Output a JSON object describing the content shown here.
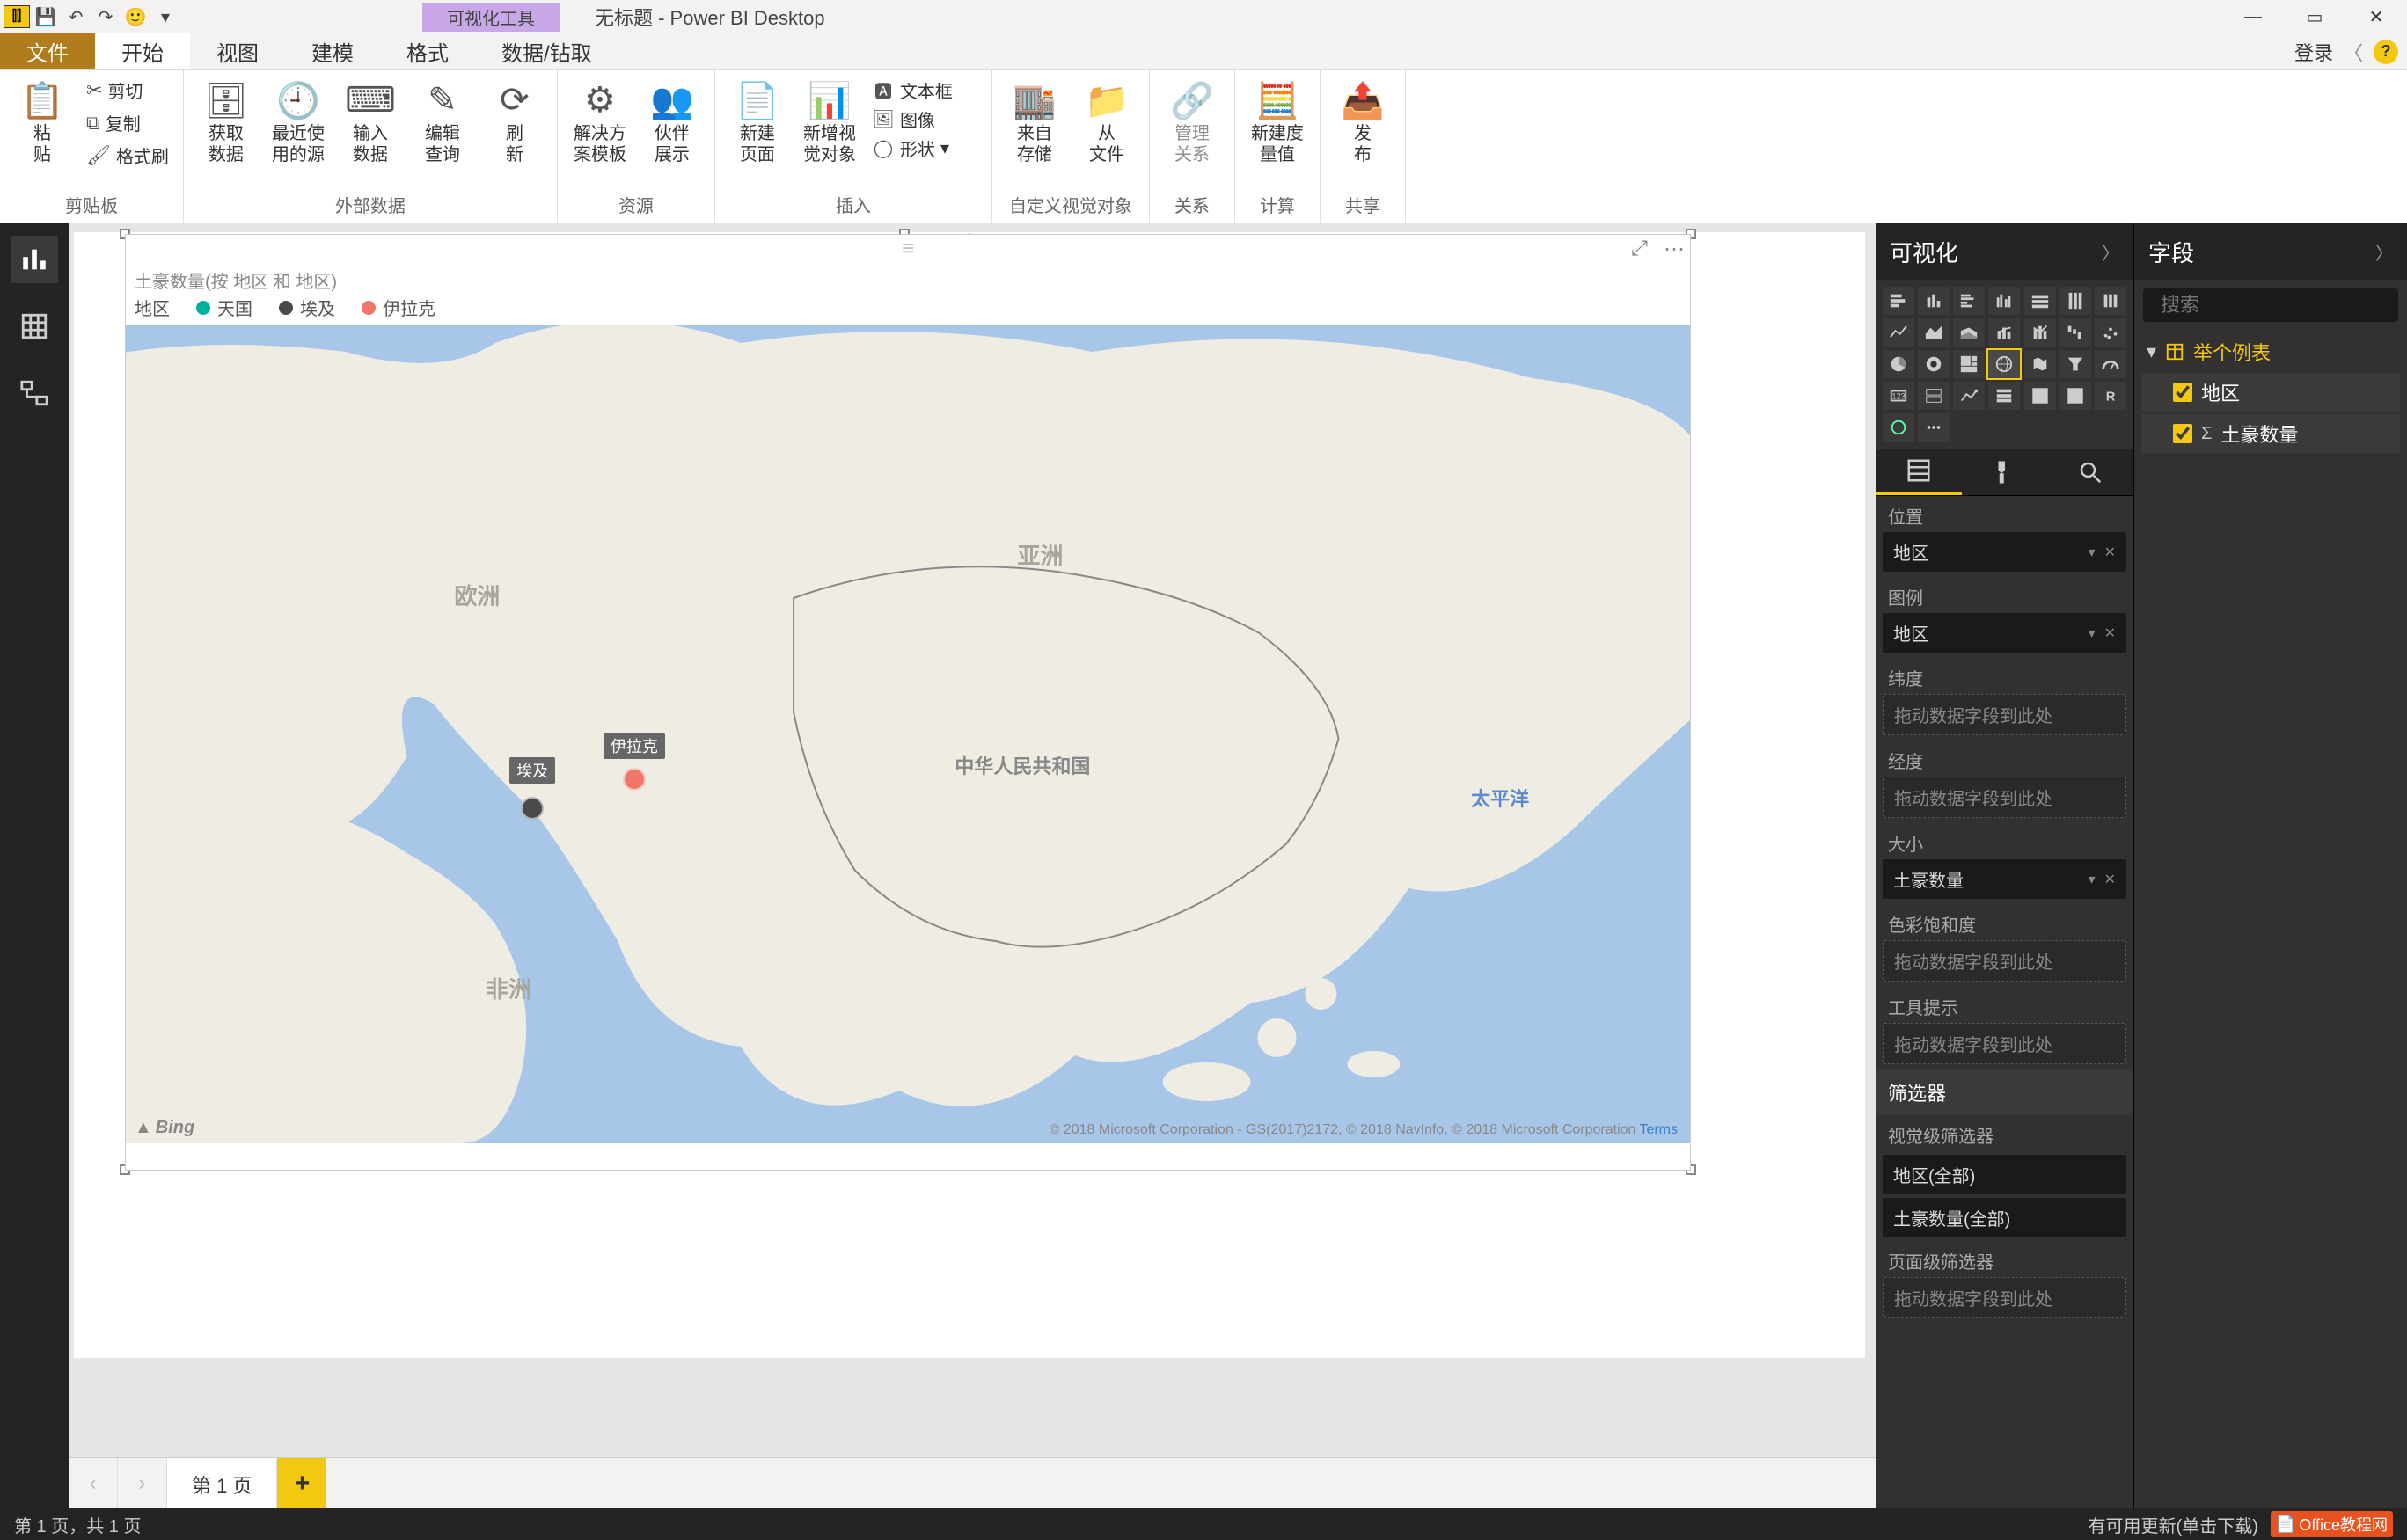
{
  "title_bar": {
    "viz_tools_label": "可视化工具",
    "title": "无标题 - Power BI Desktop",
    "qat": {
      "save": "💾",
      "undo": "↶",
      "redo": "↷",
      "smiley": "🙂"
    }
  },
  "tabs": {
    "file": "文件",
    "items": [
      "开始",
      "视图",
      "建模",
      "格式",
      "数据/钻取"
    ],
    "active": "开始",
    "signin": "登录"
  },
  "ribbon": {
    "clipboard": {
      "label": "剪贴板",
      "paste": "粘\n贴",
      "cut": "剪切",
      "copy": "复制",
      "format_painter": "格式刷"
    },
    "external_data": {
      "label": "外部数据",
      "get_data": "获取\n数据",
      "recent": "最近使\n用的源",
      "enter": "输入\n数据",
      "edit": "编辑\n查询",
      "refresh": "刷\n新"
    },
    "resources": {
      "label": "资源",
      "solutions": "解决方\n案模板",
      "partners": "伙伴\n展示"
    },
    "insert": {
      "label": "插入",
      "new_page": "新建\n页面",
      "new_visual": "新增视\n觉对象",
      "text_box": "文本框",
      "image": "图像",
      "shapes": "形状"
    },
    "custom_vis": {
      "label": "自定义视觉对象",
      "from_store": "来自\n存储",
      "from_file": "从\n文件"
    },
    "relationships": {
      "label": "关系",
      "manage": "管理\n关系"
    },
    "calc": {
      "label": "计算",
      "new_measure": "新建度\n量值"
    },
    "share": {
      "label": "共享",
      "publish": "发\n布"
    }
  },
  "visual": {
    "title": "土豪数量(按 地区 和 地区)",
    "legend_label": "地区",
    "legend": [
      {
        "name": "天国",
        "color": "#00b0a0"
      },
      {
        "name": "埃及",
        "color": "#4a4a4a"
      },
      {
        "name": "伊拉克",
        "color": "#f0766a"
      }
    ],
    "map_labels": {
      "europe": "欧洲",
      "asia": "亚洲",
      "africa": "非洲",
      "china": "中华人民共和国",
      "pacific": "太平洋"
    },
    "points": [
      {
        "name": "伊拉克",
        "x_pct": 32.5,
        "y_pct": 55.5,
        "color": "#f0766a"
      },
      {
        "name": "埃及",
        "x_pct": 26.0,
        "y_pct": 59.0,
        "color": "#4a4a4a",
        "label_dark": true
      }
    ],
    "copyright": "© 2018 Microsoft Corporation - GS(2017)2172, © 2018 NavInfo, © 2018 Microsoft Corporation",
    "terms": "Terms",
    "bing": "Bing"
  },
  "page_tabs": {
    "page1": "第 1 页"
  },
  "viz_pane": {
    "title": "可视化",
    "wells": {
      "location": {
        "label": "位置",
        "chip": "地区"
      },
      "legend": {
        "label": "图例",
        "chip": "地区"
      },
      "lat": {
        "label": "纬度",
        "placeholder": "拖动数据字段到此处"
      },
      "lng": {
        "label": "经度",
        "placeholder": "拖动数据字段到此处"
      },
      "size": {
        "label": "大小",
        "chip": "土豪数量"
      },
      "saturation": {
        "label": "色彩饱和度",
        "placeholder": "拖动数据字段到此处"
      },
      "tooltips": {
        "label": "工具提示",
        "placeholder": "拖动数据字段到此处"
      }
    },
    "filters": {
      "title": "筛选器",
      "visual_level": "视觉级筛选器",
      "items": [
        "地区(全部)",
        "土豪数量(全部)"
      ],
      "page_level": "页面级筛选器",
      "page_ph": "拖动数据字段到此处"
    }
  },
  "fields_pane": {
    "title": "字段",
    "search_ph": "搜索",
    "table": "举个例表",
    "fields": [
      {
        "name": "地区",
        "checked": true,
        "sigma": false
      },
      {
        "name": "土豪数量",
        "checked": true,
        "sigma": true
      }
    ]
  },
  "status": {
    "left": "第 1 页，共 1 页",
    "update": "有可用更新(单击下载)",
    "office_badge": "Office教程网"
  }
}
